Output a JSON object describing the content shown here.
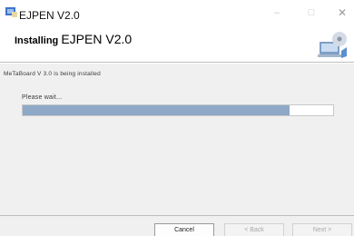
{
  "window": {
    "title": "EJPEN V2.0",
    "icon": "installer-app-icon",
    "controls": {
      "minimize": "–",
      "maximize": "□",
      "close": "✕"
    }
  },
  "header": {
    "heading_bold": "Installing",
    "heading_product": "EJPEN V2.0",
    "graphic": "installer-computer-icon"
  },
  "content": {
    "status_text": "MeTaBoard V 3.0 is being installed",
    "wait_text": "Please wait...",
    "progress_fraction": 0.86
  },
  "footer": {
    "cancel_label": "Cancel",
    "back_label": "< Back",
    "next_label": "Next >"
  },
  "colors": {
    "progress_fill": "#8ea9c8",
    "content_background": "#f0f0f0"
  }
}
